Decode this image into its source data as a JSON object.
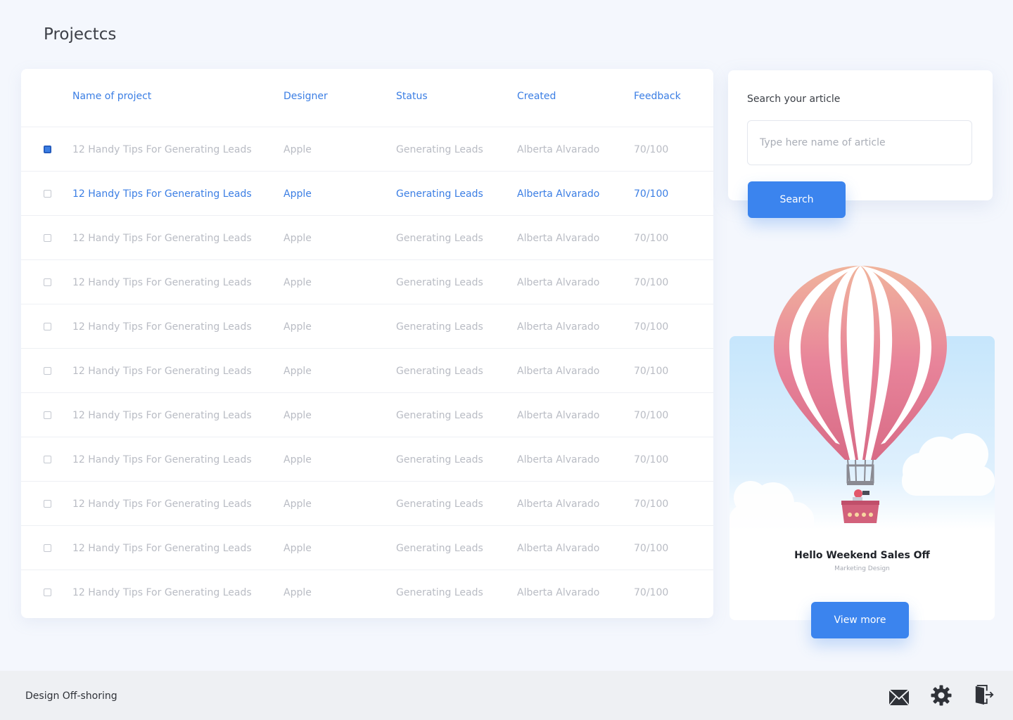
{
  "page": {
    "title": "Projectcs"
  },
  "table": {
    "headers": {
      "name": "Name of project",
      "designer": "Designer",
      "status": "Status",
      "created": "Created",
      "feedback": "Feedback"
    },
    "rows": [
      {
        "name": "12 Handy Tips For Generating Leads",
        "designer": "Apple",
        "status": "Generating Leads",
        "created": "Alberta Alvarado",
        "feedback": "70/100",
        "checked": true,
        "highlighted": false
      },
      {
        "name": "12 Handy Tips For Generating Leads",
        "designer": "Apple",
        "status": "Generating Leads",
        "created": "Alberta Alvarado",
        "feedback": "70/100",
        "checked": false,
        "highlighted": true
      },
      {
        "name": "12 Handy Tips For Generating Leads",
        "designer": "Apple",
        "status": "Generating Leads",
        "created": "Alberta Alvarado",
        "feedback": "70/100",
        "checked": false,
        "highlighted": false
      },
      {
        "name": "12 Handy Tips For Generating Leads",
        "designer": "Apple",
        "status": "Generating Leads",
        "created": "Alberta Alvarado",
        "feedback": "70/100",
        "checked": false,
        "highlighted": false
      },
      {
        "name": "12 Handy Tips For Generating Leads",
        "designer": "Apple",
        "status": "Generating Leads",
        "created": "Alberta Alvarado",
        "feedback": "70/100",
        "checked": false,
        "highlighted": false
      },
      {
        "name": "12 Handy Tips For Generating Leads",
        "designer": "Apple",
        "status": "Generating Leads",
        "created": "Alberta Alvarado",
        "feedback": "70/100",
        "checked": false,
        "highlighted": false
      },
      {
        "name": "12 Handy Tips For Generating Leads",
        "designer": "Apple",
        "status": "Generating Leads",
        "created": "Alberta Alvarado",
        "feedback": "70/100",
        "checked": false,
        "highlighted": false
      },
      {
        "name": "12 Handy Tips For Generating Leads",
        "designer": "Apple",
        "status": "Generating Leads",
        "created": "Alberta Alvarado",
        "feedback": "70/100",
        "checked": false,
        "highlighted": false
      },
      {
        "name": "12 Handy Tips For Generating Leads",
        "designer": "Apple",
        "status": "Generating Leads",
        "created": "Alberta Alvarado",
        "feedback": "70/100",
        "checked": false,
        "highlighted": false
      },
      {
        "name": "12 Handy Tips For Generating Leads",
        "designer": "Apple",
        "status": "Generating Leads",
        "created": "Alberta Alvarado",
        "feedback": "70/100",
        "checked": false,
        "highlighted": false
      },
      {
        "name": "12 Handy Tips For Generating Leads",
        "designer": "Apple",
        "status": "Generating Leads",
        "created": "Alberta Alvarado",
        "feedback": "70/100",
        "checked": false,
        "highlighted": false
      }
    ]
  },
  "search": {
    "heading": "Search your article",
    "placeholder": "Type here name of article",
    "value": "",
    "button_label": "Search"
  },
  "promo": {
    "illustration": "hot-air-balloon",
    "title": "Hello Weekend Sales Off",
    "subtitle": "Marketing Design",
    "button_label": "View more"
  },
  "footer": {
    "label": "Design Off-shoring",
    "icons": [
      "mail-icon",
      "gear-icon",
      "exit-icon"
    ]
  },
  "colors": {
    "accent": "#3b84ee",
    "link_blue": "#3b7ee4",
    "muted_text": "#b9bcc4",
    "page_bg": "#f4f7fd",
    "footer_bg": "#eef0f3",
    "balloon_pink": "#e87d91"
  }
}
